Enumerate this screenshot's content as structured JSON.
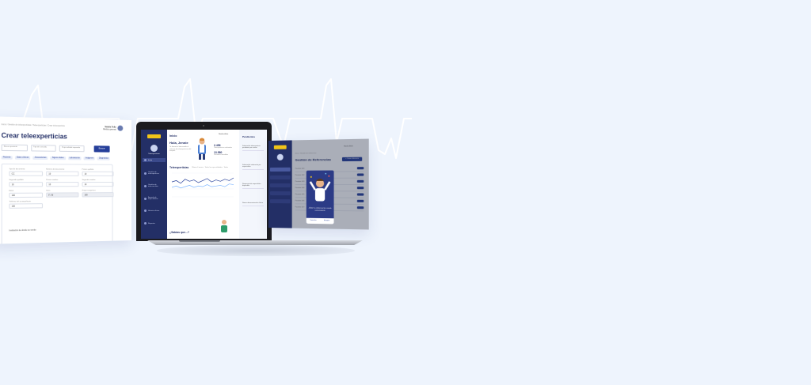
{
  "colors": {
    "background": "#eef4fd",
    "sidebar": "#232f66",
    "accent": "#263f9a",
    "brand_yellow": "#f0c419"
  },
  "left_screen": {
    "breadcrumbs": "Inicio / Gestión de teleexperticias / Teleexperticias / Crear teleexperticia",
    "user_name": "Natalia Ávila",
    "user_role": "Médico general",
    "title": "Crear teleexperticias",
    "search_fields": [
      "Buscar paciente",
      "Tipo de consulta",
      "Especialidad requerida"
    ],
    "primary_button": "Buscar",
    "tabs": [
      "Paciente",
      "Datos clínicos",
      "Antecedentes",
      "Signos vitales",
      "Laboratorios",
      "Imágenes",
      "Diagnóstico"
    ],
    "fields": [
      {
        "label": "Tipo de documento",
        "value": "CC"
      },
      {
        "label": "Número de documento",
        "value": "10"
      },
      {
        "label": "Primer apellido",
        "value": "10"
      },
      {
        "label": "Segundo apellido",
        "value": "10"
      },
      {
        "label": "Primer nombre",
        "value": "10"
      },
      {
        "label": "Segundo nombre",
        "value": "10"
      },
      {
        "label": "Edad",
        "value": "100"
      },
      {
        "label": "Sexo",
        "value": "F / M"
      },
      {
        "label": "Grupo sanguíneo",
        "value": "100"
      },
      {
        "label": "Teléfono del acompañante",
        "value": "100"
      }
    ],
    "footer": "Institución de donde se remite"
  },
  "laptop_screen": {
    "top_title": "Inicio",
    "user_name": "Natalia Ávila",
    "sidebar_label": "Teleexperticias",
    "nav_items": [
      "Inicio",
      "Gestión de teleexperticias",
      "Gestión de teleconsultas",
      "Agenda de especialistas",
      "Historia clínica",
      "Reportes"
    ],
    "greeting": "Hola, Jennie",
    "greeting_sub": "Te damos la bienvenida al sistema de teleexperticias del hospital",
    "stats": [
      {
        "value": "2.456",
        "label": "Teleexperticias realizadas"
      },
      {
        "value": "13.580",
        "label": "Pacientes atendidos"
      }
    ],
    "section_title": "Teleexperticias",
    "filters": "Últimos 6 meses · Todas las especialidades · Todos",
    "right_panel_title": "Pendientes",
    "right_panel_items": [
      "Solicitud de teleexperticia pendiente por revisar",
      "Solicitud de valoración por especialista",
      "Respuesta de especialista disponible",
      "Nueva documentación clínica"
    ],
    "know_title": "¿Sabías que...?"
  },
  "right_screen": {
    "breadcrumbs": "Inicio / Gestión de referencias",
    "title": "Gestión de Referencias",
    "button": "+ Crear referencia",
    "user_name": "Natalia Ávila",
    "rows": [
      "Paciente 001",
      "Paciente 002",
      "Paciente 003",
      "Paciente 004",
      "Paciente 005",
      "Paciente 006",
      "Paciente 007"
    ],
    "modal_text": "¡Éxito! La referencia fue creada correctamente",
    "modal_actions": [
      "Cancelar",
      "Aceptar"
    ]
  },
  "chart_data": {
    "type": "line",
    "series": [
      {
        "values": [
          22,
          24,
          20,
          26,
          23,
          25,
          21,
          24,
          27,
          22,
          25,
          23,
          26,
          24,
          28
        ]
      },
      {
        "values": [
          14,
          16,
          13,
          15,
          17,
          14,
          16,
          15,
          18,
          15,
          16,
          17,
          15,
          19,
          18
        ]
      }
    ],
    "ylim": [
      0,
      35
    ],
    "grid": true
  }
}
